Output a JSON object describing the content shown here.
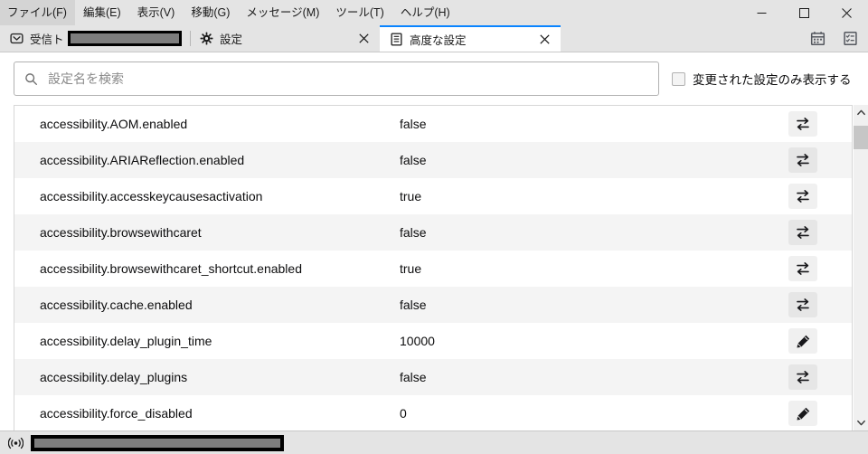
{
  "window": {
    "menus": [
      {
        "label": "ファイル(F)",
        "name": "menu-file"
      },
      {
        "label": "編集(E)",
        "name": "menu-edit"
      },
      {
        "label": "表示(V)",
        "name": "menu-view"
      },
      {
        "label": "移動(G)",
        "name": "menu-go"
      },
      {
        "label": "メッセージ(M)",
        "name": "menu-message"
      },
      {
        "label": "ツール(T)",
        "name": "menu-tools"
      },
      {
        "label": "ヘルプ(H)",
        "name": "menu-help"
      }
    ],
    "controls": {
      "minimize": "minimize-icon",
      "maximize": "maximize-icon",
      "close": "close-icon"
    }
  },
  "tabs": [
    {
      "label": "受信トレイ",
      "icon": "inbox-icon",
      "active": false,
      "redacted": true,
      "closable": false
    },
    {
      "label": "設定",
      "icon": "gear-icon",
      "active": false,
      "redacted": false,
      "closable": true
    },
    {
      "label": "高度な設定",
      "icon": "document-list-icon",
      "active": true,
      "redacted": false,
      "closable": true
    }
  ],
  "tab_tools": [
    {
      "name": "calendar-icon",
      "label": "カレンダー"
    },
    {
      "name": "tasks-icon",
      "label": "ToDo"
    }
  ],
  "search": {
    "placeholder": "設定名を検索",
    "value": "",
    "icon": "search-icon"
  },
  "filter": {
    "label": "変更された設定のみ表示する",
    "checked": false
  },
  "prefs": [
    {
      "name": "accessibility.AOM.enabled",
      "value": "false",
      "action": "toggle-icon"
    },
    {
      "name": "accessibility.ARIAReflection.enabled",
      "value": "false",
      "action": "toggle-icon"
    },
    {
      "name": "accessibility.accesskeycausesactivation",
      "value": "true",
      "action": "toggle-icon"
    },
    {
      "name": "accessibility.browsewithcaret",
      "value": "false",
      "action": "toggle-icon"
    },
    {
      "name": "accessibility.browsewithcaret_shortcut.enabled",
      "value": "true",
      "action": "toggle-icon"
    },
    {
      "name": "accessibility.cache.enabled",
      "value": "false",
      "action": "toggle-icon"
    },
    {
      "name": "accessibility.delay_plugin_time",
      "value": "10000",
      "action": "edit-icon"
    },
    {
      "name": "accessibility.delay_plugins",
      "value": "false",
      "action": "toggle-icon"
    },
    {
      "name": "accessibility.force_disabled",
      "value": "0",
      "action": "edit-icon"
    }
  ],
  "scrollbar": {
    "up": "chevron-up-icon",
    "down": "chevron-down-icon"
  },
  "statusbar": {
    "icon": "broadcast-icon",
    "redacted": true
  },
  "colors": {
    "accent": "#0a84ff",
    "chrome": "#e4e4e4",
    "row_alt": "#f4f4f4",
    "text": "#0c0c0d"
  }
}
